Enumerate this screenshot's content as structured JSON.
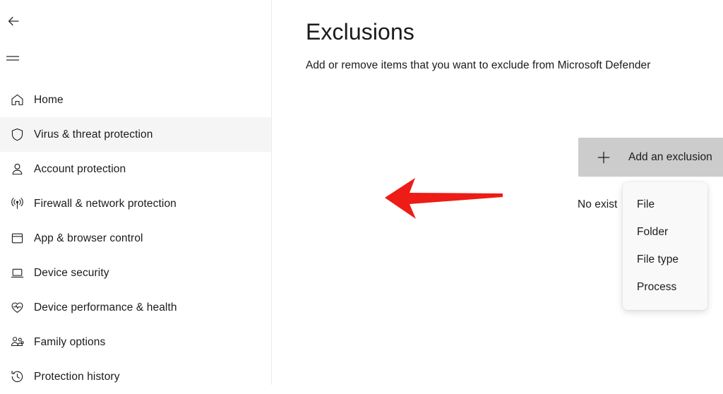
{
  "sidebar": {
    "back_icon": "back-arrow-icon",
    "menu_icon": "hamburger-menu-icon",
    "items": [
      {
        "label": "Home",
        "icon": "home-icon",
        "active": false
      },
      {
        "label": "Virus & threat protection",
        "icon": "shield-icon",
        "active": true
      },
      {
        "label": "Account protection",
        "icon": "person-icon",
        "active": false
      },
      {
        "label": "Firewall & network protection",
        "icon": "wifi-broadcast-icon",
        "active": false
      },
      {
        "label": "App & browser control",
        "icon": "app-window-icon",
        "active": false
      },
      {
        "label": "Device security",
        "icon": "laptop-icon",
        "active": false
      },
      {
        "label": "Device performance & health",
        "icon": "heart-pulse-icon",
        "active": false
      },
      {
        "label": "Family options",
        "icon": "people-group-icon",
        "active": false
      },
      {
        "label": "Protection history",
        "icon": "history-clock-icon",
        "active": false
      }
    ]
  },
  "main": {
    "title": "Exclusions",
    "subtitle": "Add or remove items that you want to exclude from Microsoft Defender",
    "add_button": {
      "label": "Add an exclusion",
      "icon": "plus-icon"
    },
    "empty_state": "No exist",
    "dropdown": {
      "items": [
        {
          "label": "File"
        },
        {
          "label": "Folder"
        },
        {
          "label": "File type"
        },
        {
          "label": "Process"
        }
      ]
    }
  },
  "annotation": {
    "arrow": "red-left-arrow",
    "color": "#ED1C16",
    "points_to": "File"
  },
  "colors": {
    "accent": "#ED1C16",
    "sidebar_active_bg": "#f5f5f5",
    "button_bg": "#cccccc",
    "text": "#1b1b1b"
  }
}
